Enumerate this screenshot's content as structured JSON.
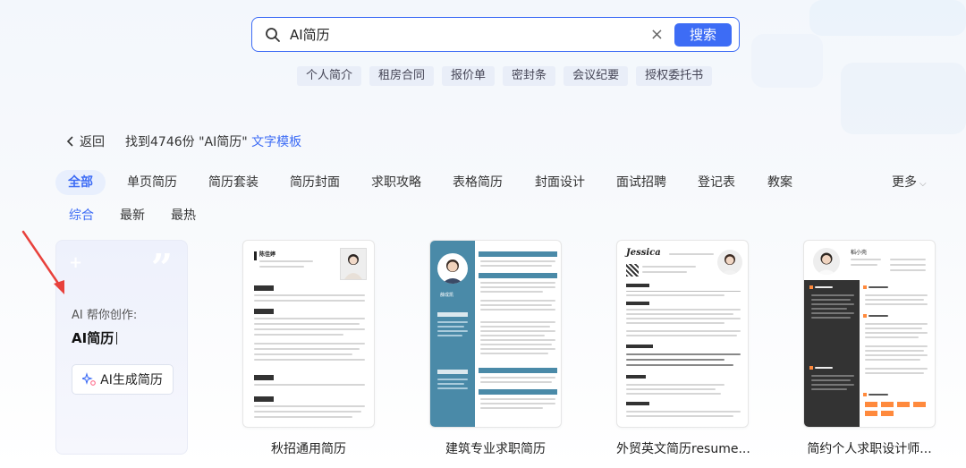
{
  "search": {
    "value": "AI简历",
    "button_label": "搜索"
  },
  "suggestions": [
    "个人简介",
    "租房合同",
    "报价单",
    "密封条",
    "会议纪要",
    "授权委托书"
  ],
  "results": {
    "back_label": "返回",
    "found_prefix": "找到4746份 \"AI简历\" ",
    "found_type": "文字模板"
  },
  "categories": {
    "items": [
      "全部",
      "单页简历",
      "简历套装",
      "简历封面",
      "求职攻略",
      "表格简历",
      "封面设计",
      "面试招聘",
      "登记表",
      "教案"
    ],
    "more_label": "更多"
  },
  "sort": {
    "items": [
      "综合",
      "最新",
      "最热"
    ]
  },
  "ai_card": {
    "help_text": "AI 帮你创作:",
    "title": "AI简历",
    "button_label": "AI生成简历"
  },
  "templates": [
    {
      "name": "秋招通用简历",
      "person": "陈佳婷"
    },
    {
      "name": "建筑专业求职简历",
      "person": "薛成凯"
    },
    {
      "name": "外贸英文简历resume...",
      "person": "Jessica"
    },
    {
      "name": "简约个人求职设计师...",
      "person": "稻小壳"
    }
  ],
  "colors": {
    "accent": "#3d6cf5",
    "teal_template": "#4a8aa8",
    "dark_template": "#333333",
    "orange_accent": "#ff8a3d"
  }
}
